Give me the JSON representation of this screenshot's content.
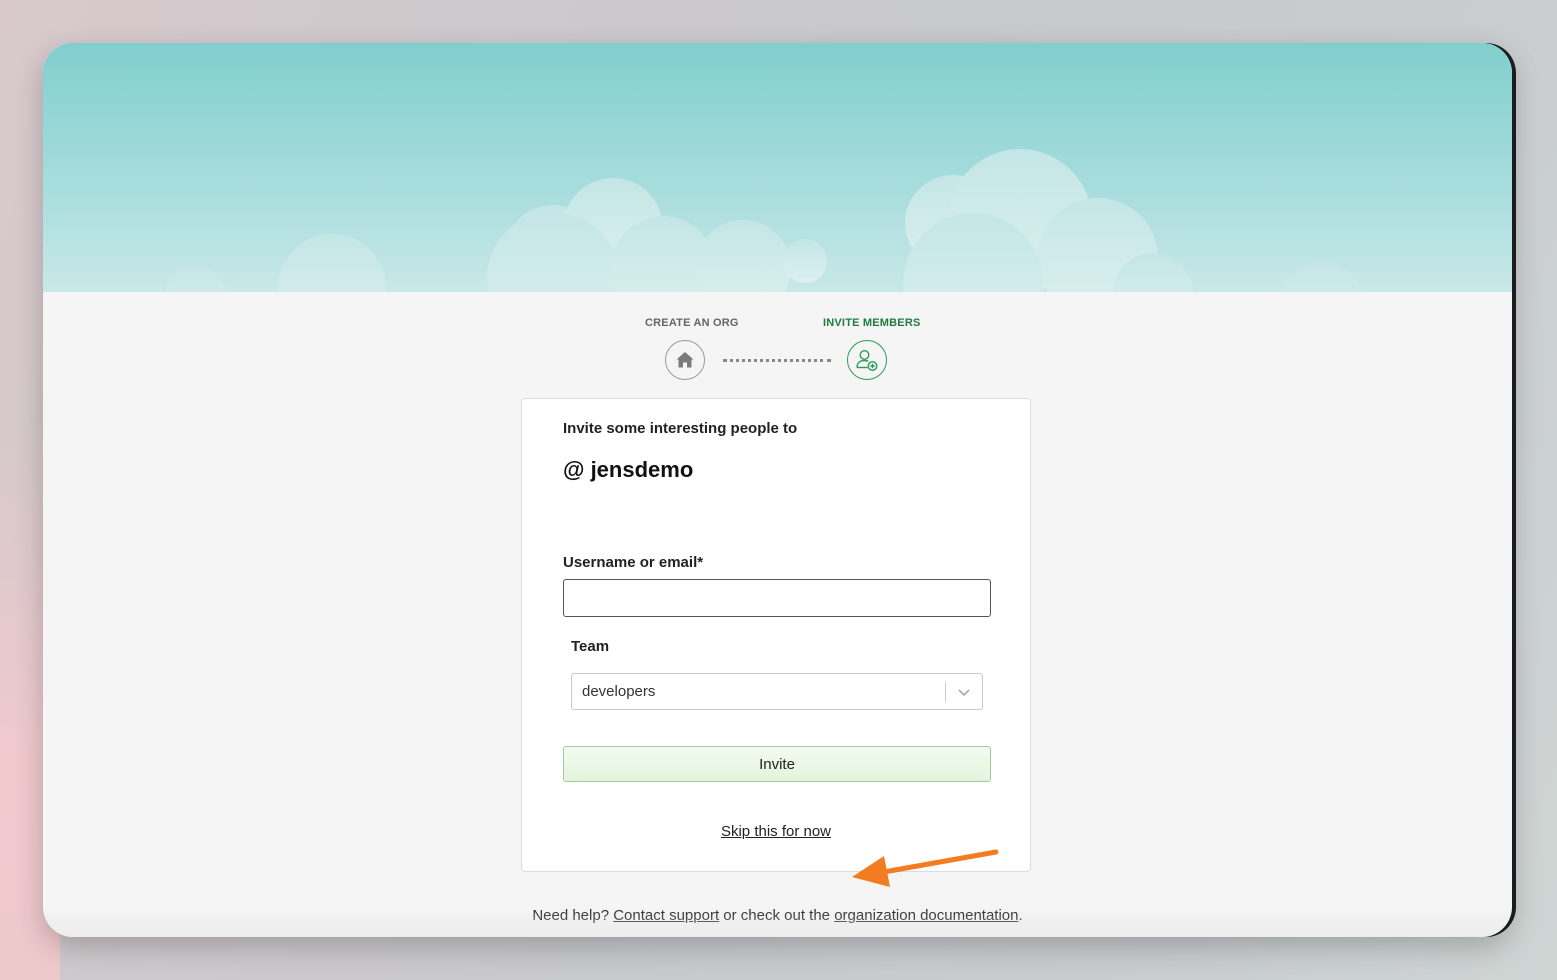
{
  "stepper": {
    "step1_label": "CREATE AN ORG",
    "step2_label": "INVITE MEMBERS",
    "step1_icon": "home-icon",
    "step2_icon": "add-user-icon",
    "active_color": "#2a9a5a"
  },
  "card": {
    "intro": "Invite some interesting people to",
    "org_name": "@ jensdemo",
    "username_label": "Username or email*",
    "username_value": "",
    "username_placeholder": "",
    "team_label": "Team",
    "team_selected": "developers",
    "invite_label": "Invite",
    "skip_label": "Skip this for now"
  },
  "footer": {
    "prefix": "Need help?",
    "support_link": "Contact support",
    "middle": "or check out the",
    "docs_link": "organization documentation",
    "suffix": "."
  },
  "annotation": {
    "arrow_color": "#f47c20"
  }
}
